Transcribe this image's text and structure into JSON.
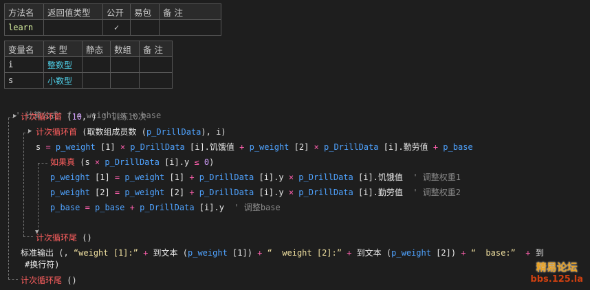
{
  "method_table": {
    "headers": [
      "方法名",
      "返回值类型",
      "公开",
      "易包",
      "备 注"
    ],
    "row": {
      "name": "learn",
      "return_type": "",
      "public_check": "✓",
      "easy_pkg": "",
      "remark": ""
    }
  },
  "var_table": {
    "headers": [
      "变量名",
      "类 型",
      "静态",
      "数组",
      "备 注"
    ],
    "rows": [
      {
        "name": "i",
        "type": "整数型",
        "static": "",
        "array": "",
        "remark": ""
      },
      {
        "name": "s",
        "type": "小数型",
        "static": "",
        "array": "",
        "remark": ""
      }
    ]
  },
  "code": {
    "l1_comment": "' 计算公式：f = weight.x + base",
    "l2_kw": "计次循环首",
    "l2_open": " (",
    "l2_num": "10",
    "l2_rest": ", ) ",
    "l2_comment": "' 训练10次",
    "l3_kw": "计次循环首",
    "l3_open": " (",
    "l3_fn": "取数组成员数",
    "l3_open2": " (",
    "l3_var": "p_DrillData",
    "l3_close": "), i)",
    "l4": {
      "a": "s",
      "eq": " = ",
      "w": "p_weight",
      "i1": " [1] ",
      "x1": "×",
      "d1": " p_DrillData",
      "i2": " [i].",
      "f1": "饥饿值",
      "p1": " + ",
      "w2": "p_weight",
      "i3": " [2] ",
      "x2": "×",
      "d2": " p_DrillData",
      "i4": " [i].",
      "f2": "勤劳值",
      "p2": " + ",
      "b": "p_base"
    },
    "l5": {
      "kw": "如果真",
      "open": " (s ",
      "x": "×",
      "d": " p_DrillData",
      "i": " [i].y ",
      "le": "≤",
      "z": " 0",
      "close": ")"
    },
    "l6": {
      "w": "p_weight",
      "i1": " [1] ",
      "eq": "=",
      "w2": " p_weight",
      "i2": " [1] ",
      "p": "+",
      "d": " p_DrillData",
      "i3": " [i].y ",
      "x": "×",
      "d2": " p_DrillData",
      "i4": " [i].",
      "f": "饥饿值",
      "cm": "  ' 调整权重1"
    },
    "l7": {
      "w": "p_weight",
      "i1": " [2] ",
      "eq": "=",
      "w2": " p_weight",
      "i2": " [2] ",
      "p": "+",
      "d": " p_DrillData",
      "i3": " [i].y ",
      "x": "×",
      "d2": " p_DrillData",
      "i4": " [i].",
      "f": "勤劳值",
      "cm": "  ' 调整权重2"
    },
    "l8": {
      "b": "p_base",
      "eq": " = ",
      "b2": "p_base",
      "p": " + ",
      "d": "p_DrillData",
      "i": " [i].y",
      "cm": "  ' 调整base"
    },
    "l9_kw": "计次循环尾",
    "l9_rest": " ()",
    "l10": {
      "fn": "标准输出",
      "open": " (, ",
      "s1": "“weight [1]:”",
      "p1": " + ",
      "f1": "到文本",
      "o1": " (",
      "v1": "p_weight",
      "i1": " [1]) ",
      "p2": "+ ",
      "s2": "“  weight [2]:”",
      "p3": " + ",
      "f2": "到文本",
      "o2": " (",
      "v2": "p_weight",
      "i2": " [2]) ",
      "p4": "+ ",
      "s3": "“  base:”",
      "p5": "  + ",
      "f3": "到"
    },
    "l11": "#换行符)",
    "l12_kw": "计次循环尾",
    "l12_rest": " ()"
  },
  "watermark": {
    "line1": "精易论坛",
    "line2": "bbs.125.la"
  }
}
